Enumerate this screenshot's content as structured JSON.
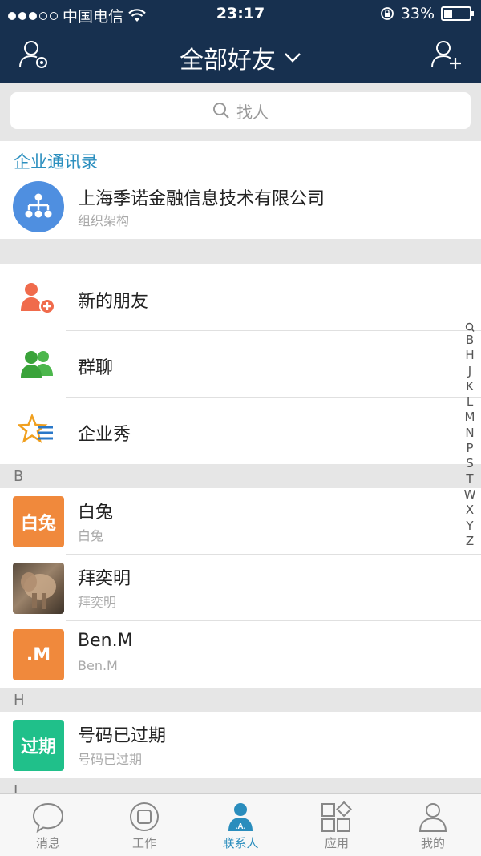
{
  "status_bar": {
    "carrier": "中国电信",
    "time": "23:17",
    "battery_percent": "33%",
    "battery_level": 0.33
  },
  "nav": {
    "title": "全部好友",
    "left_icon": "user-settings-icon",
    "right_icon": "add-user-icon"
  },
  "search": {
    "placeholder": "找人"
  },
  "enterprise": {
    "section_title": "企业通讯录",
    "company_name": "上海季诺金融信息技术有限公司",
    "subtitle": "组织架构"
  },
  "features": [
    {
      "label": "新的朋友",
      "icon": "new-friend-icon"
    },
    {
      "label": "群聊",
      "icon": "group-chat-icon"
    },
    {
      "label": "企业秀",
      "icon": "enterprise-show-icon"
    }
  ],
  "groups": [
    {
      "letter": "B",
      "contacts": [
        {
          "name": "白兔",
          "sub": "白兔",
          "avatar_text": "白兔",
          "avatar_color": "#f0893c"
        },
        {
          "name": "拜奕明",
          "sub": "拜奕明",
          "avatar_text": "",
          "avatar_color": "#6b5a4a"
        },
        {
          "name": "Ben.M",
          "sub": "Ben.M",
          "avatar_text": ".M",
          "avatar_color": "#f0893c"
        }
      ]
    },
    {
      "letter": "H",
      "contacts": [
        {
          "name": "号码已过期",
          "sub": "号码已过期",
          "avatar_text": "过期",
          "avatar_color": "#20c08a"
        }
      ]
    },
    {
      "letter": "J",
      "contacts": []
    }
  ],
  "index_letters": [
    "B",
    "H",
    "J",
    "K",
    "L",
    "M",
    "N",
    "P",
    "S",
    "T",
    "W",
    "X",
    "Y",
    "Z"
  ],
  "tabs": [
    {
      "label": "消息",
      "icon": "message-icon",
      "active": false
    },
    {
      "label": "工作",
      "icon": "work-icon",
      "active": false
    },
    {
      "label": "联系人",
      "icon": "contacts-icon",
      "active": true
    },
    {
      "label": "应用",
      "icon": "apps-icon",
      "active": false
    },
    {
      "label": "我的",
      "icon": "me-icon",
      "active": false
    }
  ],
  "colors": {
    "header_bg": "#17304f",
    "accent": "#2a8dbd",
    "orange": "#f0893c",
    "green": "#20c08a"
  }
}
